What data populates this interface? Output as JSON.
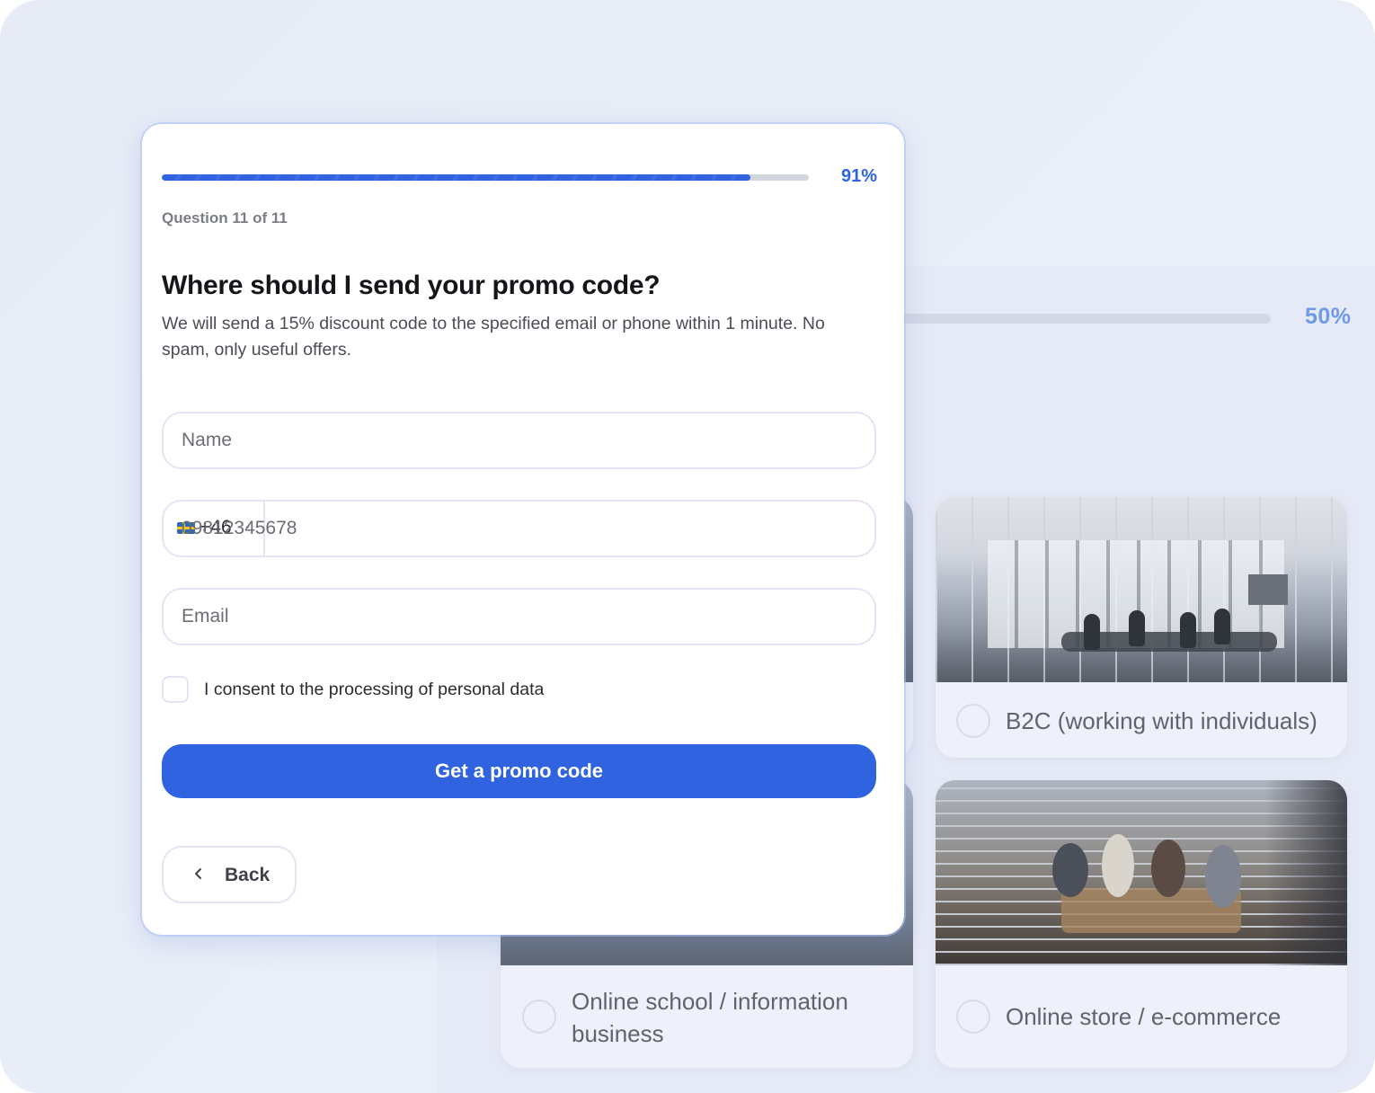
{
  "background": {
    "progress_percent": "50%",
    "progress_value": 0.5,
    "options": [
      {
        "label": "B2C (working with individuals)",
        "photo": "office-meeting-room-photo"
      },
      {
        "label": "Online school / information business",
        "photo": "team-meeting-photo"
      },
      {
        "label": "Online store / e-commerce",
        "photo": "cafe-team-photo"
      }
    ]
  },
  "modal": {
    "progress_percent": "91%",
    "progress_value": 0.91,
    "question_counter": "Question 11 of 11",
    "title": "Where should I send your promo code?",
    "subtitle": "We will send a 15% discount code to the specified email or phone within 1 minute. No spam, only useful offers.",
    "name_field": {
      "placeholder": "Name",
      "value": ""
    },
    "phone_field": {
      "country_flag": "sweden-flag-icon",
      "dial_code": "+46",
      "placeholder": "09812345678",
      "value": ""
    },
    "email_field": {
      "placeholder": "Email",
      "value": ""
    },
    "consent_label": "I consent to the processing of personal data",
    "consent_checked": false,
    "submit_label": "Get a promo code",
    "back_label": "Back"
  },
  "colors": {
    "accent": "#2f63df",
    "track": "#d2d6dd",
    "field_border": "#e2e6f3",
    "background_accent": "#6f9ae8"
  }
}
